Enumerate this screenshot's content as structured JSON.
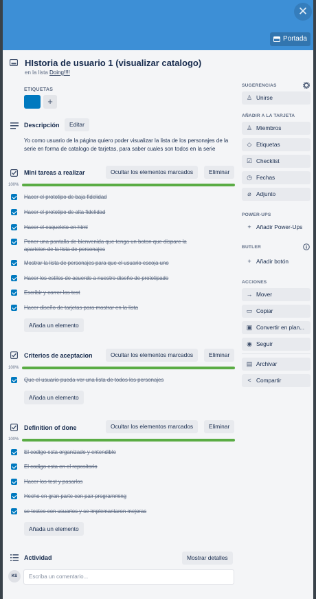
{
  "cover": {
    "color": "#3d8fd6",
    "close_icon": "close-icon",
    "cover_button_label": "Portada"
  },
  "card": {
    "title": "HIstoria de usuario 1 (visualizar catalogo)",
    "list_prefix": "en la lista",
    "list_name": "Doing!!!!"
  },
  "labels": {
    "header": "ETIQUETAS",
    "chip_color": "#0079bf",
    "add_symbol": "+"
  },
  "description": {
    "title": "Descripción",
    "edit_label": "Editar",
    "text": "Yo como usuario de la página quiero poder visualizar la lista de los personajes de la serie en forma de catalogo de tarjetas, para saber cuales son todos en la serie"
  },
  "checklists": [
    {
      "title": "MIni tareas a realizar",
      "hide_label": "Ocultar los elementos marcados",
      "delete_label": "Eliminar",
      "progress": "100%",
      "items": [
        {
          "text": "Hacer el prototipo de baja fidelidad"
        },
        {
          "text": "Hacer el prototipo de alta fidelidad"
        },
        {
          "text": "Hacer el esqueleto en html"
        },
        {
          "text": "Poner una pantalla de bienvenida que tenga un boton que dispare la aparicion de la lista de personajes"
        },
        {
          "text": "Mostrar la lista de personajes para que el usuario escoja uno"
        },
        {
          "text": "Hacer los estilos de acuerdo a nuestro diseño de prototipado"
        },
        {
          "text": "Escribir y correr los test"
        },
        {
          "text": "Hacer diseño de tarjetas para mostrar en la lista"
        }
      ],
      "add_label": "Añada un elemento"
    },
    {
      "title": "Criterios de aceptacion",
      "hide_label": "Ocultar los elementos marcados",
      "delete_label": "Eliminar",
      "progress": "100%",
      "items": [
        {
          "text": "Que el usuario pueda ver una lista de todos los personajes"
        }
      ],
      "add_label": "Añada un elemento"
    },
    {
      "title": "Definition of done",
      "hide_label": "Ocultar los elementos marcados",
      "delete_label": "Eliminar",
      "progress": "100%",
      "items": [
        {
          "text": "El codigo esta organizado y entendible"
        },
        {
          "text": "El codigo esta en el repositorio"
        },
        {
          "text": "Hacer los test y pasarlos"
        },
        {
          "text": "Hecho en gran parte con pair programming"
        },
        {
          "text": "se testeo con usuarios y se implemantaron mejoras"
        }
      ],
      "add_label": "Añada un elemento"
    }
  ],
  "activity": {
    "title": "Actividad",
    "show_details_label": "Mostrar detalles",
    "avatar_initials": "KS",
    "comment_placeholder": "Escriba un comentario..."
  },
  "sidebar": {
    "suggestions_header": "SUGERENCIAS",
    "join_label": "Unirse",
    "add_header": "AÑADIR A LA TARJETA",
    "add_items": [
      "Miembros",
      "Etiquetas",
      "Checklist",
      "Fechas",
      "Adjunto"
    ],
    "powerups_header": "POWER-UPS",
    "powerups_add_label": "Añadir Power-Ups",
    "butler_header": "BUTLER",
    "butler_add_label": "Añadir botón",
    "actions_header": "ACCIONES",
    "actions": [
      "Mover",
      "Copiar",
      "Convertir en plan...",
      "Seguir",
      "Archivar",
      "Compartir"
    ]
  },
  "progress_color": "#5aac44",
  "checkbox_color": "#0079bf"
}
